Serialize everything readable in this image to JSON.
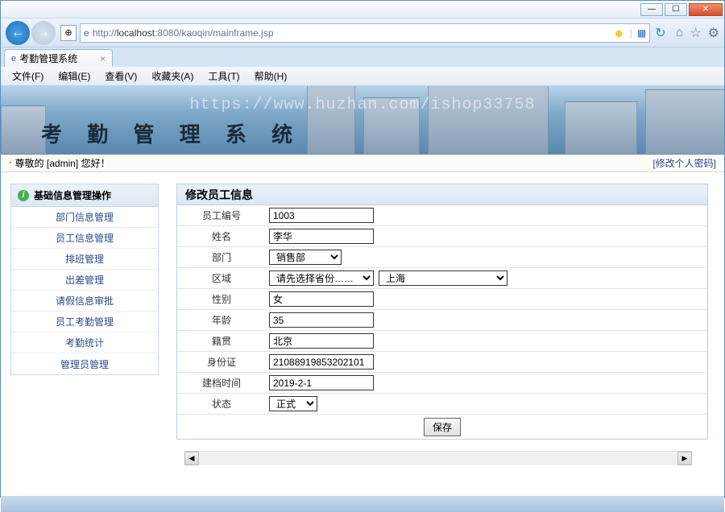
{
  "window": {
    "url_prefix": "http://",
    "url_host": "localhost",
    "url_path": ":8080/kaoqin/mainframe.jsp"
  },
  "tab": {
    "title": "考勤管理系统"
  },
  "menu": {
    "file": "文件(F)",
    "edit": "编辑(E)",
    "view": "查看(V)",
    "favorites": "收藏夹(A)",
    "tools": "工具(T)",
    "help": "帮助(H)"
  },
  "banner": {
    "watermark": "https://www.huzhan.com/ishop33758",
    "title": "考 勤 管 理 系 统"
  },
  "greet": {
    "prefix": "尊敬的 [",
    "user": "admin",
    "suffix": "] 您好！",
    "change_pw": "[修改个人密码]"
  },
  "sidebar": {
    "header": "基础信息管理操作",
    "items": [
      "部门信息管理",
      "员工信息管理",
      "排班管理",
      "出差管理",
      "请假信息审批",
      "员工考勤管理",
      "考勤统计",
      "管理员管理"
    ]
  },
  "form": {
    "title": "修改员工信息",
    "labels": {
      "emp_no": "员工编号",
      "name": "姓名",
      "dept": "部门",
      "region": "区域",
      "gender": "性别",
      "age": "年龄",
      "hometown": "籍贯",
      "id_card": "身份证",
      "created": "建档时间",
      "status": "状态"
    },
    "values": {
      "emp_no": "1003",
      "name": "李华",
      "dept": "销售部",
      "province": "请先选择省份……",
      "city": "上海",
      "gender": "女",
      "age": "35",
      "hometown": "北京",
      "id_card": "21088919853202101",
      "created": "2019-2-1",
      "status": "正式"
    },
    "save": "保存"
  }
}
